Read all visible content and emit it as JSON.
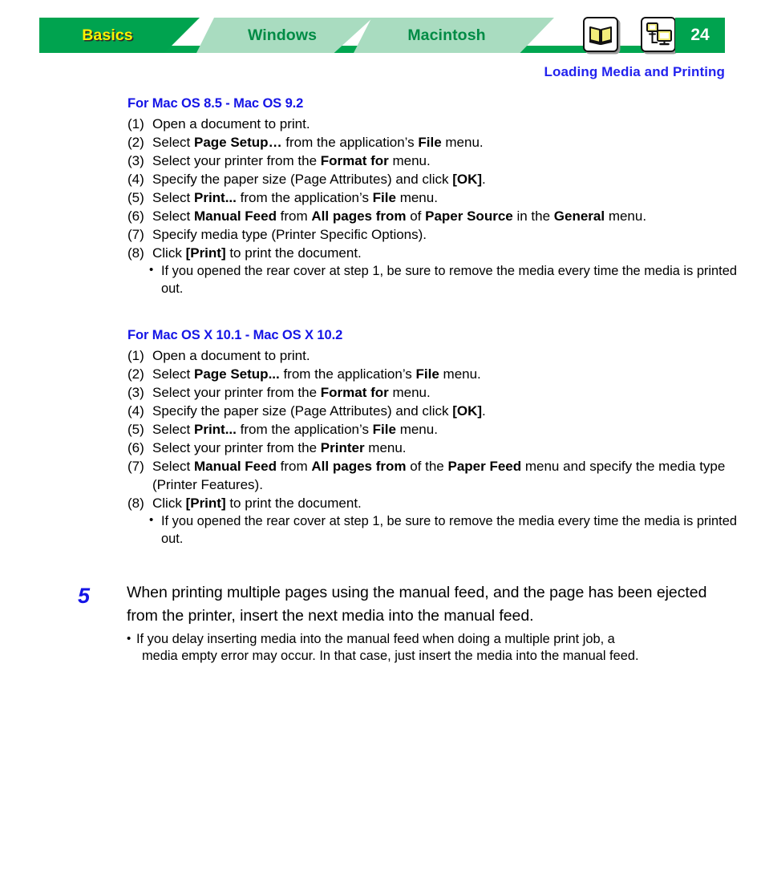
{
  "header": {
    "tabs": [
      {
        "label": "Basics",
        "state": "active"
      },
      {
        "label": "Windows",
        "state": "inactive"
      },
      {
        "label": "Macintosh",
        "state": "inactive"
      }
    ],
    "icons": [
      {
        "name": "book-icon"
      },
      {
        "name": "network-computers-icon"
      }
    ],
    "page_number": "24",
    "subtitle": "Loading Media and Printing",
    "colors": {
      "active_tab_bg": "#00A34F",
      "inactive_tab_bg": "#A9DCC0",
      "active_tab_text": "#FFF100",
      "inactive_tab_text": "#008B45",
      "page_number_bg": "#00A34F",
      "subtitle_text": "#2222EE"
    }
  },
  "sections": [
    {
      "heading": "For Mac OS 8.5 - Mac OS 9.2",
      "steps": [
        {
          "marker": "(1)",
          "text_html": "Open a document to print."
        },
        {
          "marker": "(2)",
          "text_html": "Select <b>Page Setup…</b> from the application’s <b>File</b> menu."
        },
        {
          "marker": "(3)",
          "text_html": "Select your printer from the <b>Format for</b> menu."
        },
        {
          "marker": "(4)",
          "text_html": "Specify the paper size (Page Attributes) and click <b>[OK]</b>."
        },
        {
          "marker": "(5)",
          "text_html": "Select <b>Print...</b> from the application’s <b>File</b> menu."
        },
        {
          "marker": "(6)",
          "text_html": "Select <b>Manual Feed</b> from <b>All pages from</b> of <b>Paper Source</b> in the <b>General</b> menu."
        },
        {
          "marker": "(7)",
          "text_html": "Specify media type (Printer Specific Options)."
        },
        {
          "marker": "(8)",
          "text_html": "Click <b>[Print]</b> to print the document."
        }
      ],
      "note_html": "If you opened the rear cover at step 1, be sure to remove the media every time the media is printed out."
    },
    {
      "heading": "For Mac OS X 10.1 - Mac OS X 10.2",
      "steps": [
        {
          "marker": "(1)",
          "text_html": "Open a document to print."
        },
        {
          "marker": "(2)",
          "text_html": "Select <b>Page Setup...</b> from the application’s <b>File</b> menu."
        },
        {
          "marker": "(3)",
          "text_html": "Select your printer from the <b>Format for</b> menu."
        },
        {
          "marker": "(4)",
          "text_html": "Specify the paper size (Page Attributes) and click <b>[OK]</b>."
        },
        {
          "marker": "(5)",
          "text_html": "Select <b>Print...</b> from the application’s <b>File</b> menu."
        },
        {
          "marker": "(6)",
          "text_html": "Select your printer from the <b>Printer</b> menu."
        },
        {
          "marker": "(7)",
          "text_html": "Select <b>Manual Feed</b> from <b>All pages from</b> of the <b>Paper Feed</b> menu and specify the media type (Printer Features)."
        },
        {
          "marker": "(8)",
          "text_html": "Click <b>[Print]</b> to print the document."
        }
      ],
      "note_html": "If you opened the rear cover at step 1, be sure to remove the media every time the media is printed out."
    }
  ],
  "big_step": {
    "number": "5",
    "number_color": "#1414E6",
    "text": "When printing multiple pages using the manual feed, and the page has been ejected from the printer, insert the next media into the manual feed.",
    "note_line_1": "If you delay inserting media into the manual feed when doing a multiple print job, a",
    "note_line_2": "media empty error may occur. In that case, just insert the media into the manual feed."
  }
}
